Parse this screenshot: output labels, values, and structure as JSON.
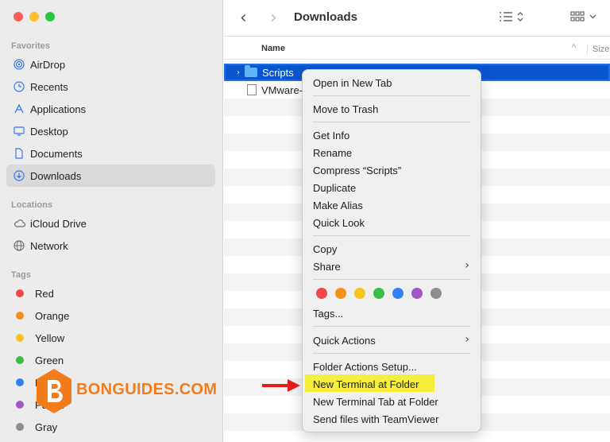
{
  "sidebar": {
    "favorites_title": "Favorites",
    "favorites": [
      {
        "label": "AirDrop",
        "icon": "airdrop-icon"
      },
      {
        "label": "Recents",
        "icon": "clock-icon"
      },
      {
        "label": "Applications",
        "icon": "applications-icon"
      },
      {
        "label": "Desktop",
        "icon": "desktop-icon"
      },
      {
        "label": "Documents",
        "icon": "document-icon"
      },
      {
        "label": "Downloads",
        "icon": "download-icon",
        "selected": true
      }
    ],
    "locations_title": "Locations",
    "locations": [
      {
        "label": "iCloud Drive",
        "icon": "cloud-icon"
      },
      {
        "label": "Network",
        "icon": "globe-icon"
      }
    ],
    "tags_title": "Tags",
    "tags": [
      {
        "label": "Red",
        "color": "#f04848"
      },
      {
        "label": "Orange",
        "color": "#f5901e"
      },
      {
        "label": "Yellow",
        "color": "#f7c51d"
      },
      {
        "label": "Green",
        "color": "#3bbd45"
      },
      {
        "label": "Blue",
        "color": "#2f82f0"
      },
      {
        "label": "Purple",
        "color": "#a356c7"
      },
      {
        "label": "Gray",
        "color": "#8e8e8e"
      }
    ]
  },
  "toolbar": {
    "title": "Downloads",
    "back_icon": "chevron-left-icon",
    "forward_icon": "chevron-right-icon",
    "view_icon": "list-view-icon",
    "group_icon": "grid-group-icon"
  },
  "columns": {
    "name": "Name",
    "size": "Size"
  },
  "files": [
    {
      "name": "Scripts",
      "kind": "folder",
      "selected": true
    },
    {
      "name": "VMware-",
      "kind": "file"
    }
  ],
  "context_menu": {
    "items": {
      "open_new_tab": "Open in New Tab",
      "move_trash": "Move to Trash",
      "get_info": "Get Info",
      "rename": "Rename",
      "compress": "Compress “Scripts”",
      "duplicate": "Duplicate",
      "make_alias": "Make Alias",
      "quick_look": "Quick Look",
      "copy": "Copy",
      "share": "Share",
      "tags": "Tags...",
      "quick_actions": "Quick Actions",
      "folder_actions": "Folder Actions Setup...",
      "new_terminal": "New Terminal at Folder",
      "new_terminal_tab": "New Terminal Tab at Folder",
      "teamviewer": "Send files with TeamViewer"
    },
    "tag_colors": [
      "#f04848",
      "#f5901e",
      "#f7c51d",
      "#3bbd45",
      "#2f82f0",
      "#a356c7",
      "#8e8e8e"
    ],
    "highlight_color": "#f5ee3c"
  },
  "watermark": {
    "text": "BONGUIDES.COM",
    "color": "#f27b1a"
  }
}
